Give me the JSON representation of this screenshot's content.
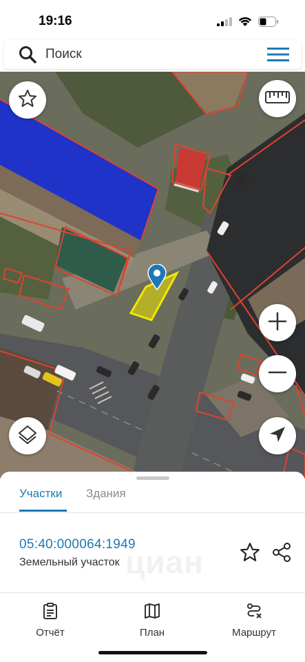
{
  "status_bar": {
    "time": "19:16",
    "signal_icon": "cellular-signal-icon",
    "wifi_icon": "wifi-icon",
    "battery_icon": "battery-icon"
  },
  "search": {
    "placeholder": "Поиск",
    "search_icon": "magnifier-icon",
    "menu_icon": "hamburger-menu-icon"
  },
  "map": {
    "buttons": {
      "favorite": "star-icon",
      "ruler": "ruler-icon",
      "zoom_in": "plus-icon",
      "zoom_out": "minus-icon",
      "layers": "layers-icon",
      "locate": "navigation-arrow-icon"
    },
    "highlight_color": "#f2e600",
    "boundary_color": "#e0432f",
    "marker_color": "#1c79b5"
  },
  "sheet": {
    "tabs": [
      {
        "label": "Участки",
        "active": true
      },
      {
        "label": "Здания",
        "active": false
      }
    ],
    "parcel": {
      "cadastral_number": "05:40:000064:1949",
      "type": "Земельный участок",
      "watermark": "циан"
    },
    "actions": {
      "favorite_icon": "star-outline-icon",
      "share_icon": "share-icon"
    },
    "nav": [
      {
        "label": "Отчёт",
        "icon": "report-clipboard-icon"
      },
      {
        "label": "План",
        "icon": "map-plan-icon"
      },
      {
        "label": "Маршрут",
        "icon": "route-icon"
      }
    ]
  },
  "colors": {
    "accent": "#1c79b5"
  }
}
